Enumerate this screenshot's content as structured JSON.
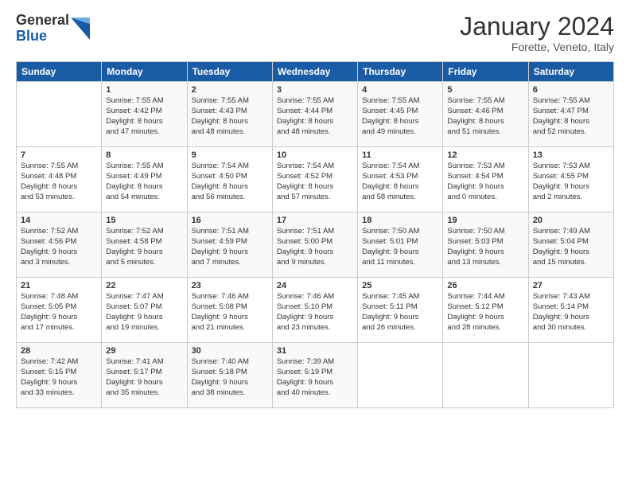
{
  "logo": {
    "general": "General",
    "blue": "Blue"
  },
  "title": "January 2024",
  "subtitle": "Forette, Veneto, Italy",
  "headers": [
    "Sunday",
    "Monday",
    "Tuesday",
    "Wednesday",
    "Thursday",
    "Friday",
    "Saturday"
  ],
  "weeks": [
    [
      {
        "day": "",
        "info": ""
      },
      {
        "day": "1",
        "info": "Sunrise: 7:55 AM\nSunset: 4:42 PM\nDaylight: 8 hours\nand 47 minutes."
      },
      {
        "day": "2",
        "info": "Sunrise: 7:55 AM\nSunset: 4:43 PM\nDaylight: 8 hours\nand 48 minutes."
      },
      {
        "day": "3",
        "info": "Sunrise: 7:55 AM\nSunset: 4:44 PM\nDaylight: 8 hours\nand 48 minutes."
      },
      {
        "day": "4",
        "info": "Sunrise: 7:55 AM\nSunset: 4:45 PM\nDaylight: 8 hours\nand 49 minutes."
      },
      {
        "day": "5",
        "info": "Sunrise: 7:55 AM\nSunset: 4:46 PM\nDaylight: 8 hours\nand 51 minutes."
      },
      {
        "day": "6",
        "info": "Sunrise: 7:55 AM\nSunset: 4:47 PM\nDaylight: 8 hours\nand 52 minutes."
      }
    ],
    [
      {
        "day": "7",
        "info": "Sunrise: 7:55 AM\nSunset: 4:48 PM\nDaylight: 8 hours\nand 53 minutes."
      },
      {
        "day": "8",
        "info": "Sunrise: 7:55 AM\nSunset: 4:49 PM\nDaylight: 8 hours\nand 54 minutes."
      },
      {
        "day": "9",
        "info": "Sunrise: 7:54 AM\nSunset: 4:50 PM\nDaylight: 8 hours\nand 56 minutes."
      },
      {
        "day": "10",
        "info": "Sunrise: 7:54 AM\nSunset: 4:52 PM\nDaylight: 8 hours\nand 57 minutes."
      },
      {
        "day": "11",
        "info": "Sunrise: 7:54 AM\nSunset: 4:53 PM\nDaylight: 8 hours\nand 58 minutes."
      },
      {
        "day": "12",
        "info": "Sunrise: 7:53 AM\nSunset: 4:54 PM\nDaylight: 9 hours\nand 0 minutes."
      },
      {
        "day": "13",
        "info": "Sunrise: 7:53 AM\nSunset: 4:55 PM\nDaylight: 9 hours\nand 2 minutes."
      }
    ],
    [
      {
        "day": "14",
        "info": "Sunrise: 7:52 AM\nSunset: 4:56 PM\nDaylight: 9 hours\nand 3 minutes."
      },
      {
        "day": "15",
        "info": "Sunrise: 7:52 AM\nSunset: 4:58 PM\nDaylight: 9 hours\nand 5 minutes."
      },
      {
        "day": "16",
        "info": "Sunrise: 7:51 AM\nSunset: 4:59 PM\nDaylight: 9 hours\nand 7 minutes."
      },
      {
        "day": "17",
        "info": "Sunrise: 7:51 AM\nSunset: 5:00 PM\nDaylight: 9 hours\nand 9 minutes."
      },
      {
        "day": "18",
        "info": "Sunrise: 7:50 AM\nSunset: 5:01 PM\nDaylight: 9 hours\nand 11 minutes."
      },
      {
        "day": "19",
        "info": "Sunrise: 7:50 AM\nSunset: 5:03 PM\nDaylight: 9 hours\nand 13 minutes."
      },
      {
        "day": "20",
        "info": "Sunrise: 7:49 AM\nSunset: 5:04 PM\nDaylight: 9 hours\nand 15 minutes."
      }
    ],
    [
      {
        "day": "21",
        "info": "Sunrise: 7:48 AM\nSunset: 5:05 PM\nDaylight: 9 hours\nand 17 minutes."
      },
      {
        "day": "22",
        "info": "Sunrise: 7:47 AM\nSunset: 5:07 PM\nDaylight: 9 hours\nand 19 minutes."
      },
      {
        "day": "23",
        "info": "Sunrise: 7:46 AM\nSunset: 5:08 PM\nDaylight: 9 hours\nand 21 minutes."
      },
      {
        "day": "24",
        "info": "Sunrise: 7:46 AM\nSunset: 5:10 PM\nDaylight: 9 hours\nand 23 minutes."
      },
      {
        "day": "25",
        "info": "Sunrise: 7:45 AM\nSunset: 5:11 PM\nDaylight: 9 hours\nand 26 minutes."
      },
      {
        "day": "26",
        "info": "Sunrise: 7:44 AM\nSunset: 5:12 PM\nDaylight: 9 hours\nand 28 minutes."
      },
      {
        "day": "27",
        "info": "Sunrise: 7:43 AM\nSunset: 5:14 PM\nDaylight: 9 hours\nand 30 minutes."
      }
    ],
    [
      {
        "day": "28",
        "info": "Sunrise: 7:42 AM\nSunset: 5:15 PM\nDaylight: 9 hours\nand 33 minutes."
      },
      {
        "day": "29",
        "info": "Sunrise: 7:41 AM\nSunset: 5:17 PM\nDaylight: 9 hours\nand 35 minutes."
      },
      {
        "day": "30",
        "info": "Sunrise: 7:40 AM\nSunset: 5:18 PM\nDaylight: 9 hours\nand 38 minutes."
      },
      {
        "day": "31",
        "info": "Sunrise: 7:39 AM\nSunset: 5:19 PM\nDaylight: 9 hours\nand 40 minutes."
      },
      {
        "day": "",
        "info": ""
      },
      {
        "day": "",
        "info": ""
      },
      {
        "day": "",
        "info": ""
      }
    ]
  ]
}
